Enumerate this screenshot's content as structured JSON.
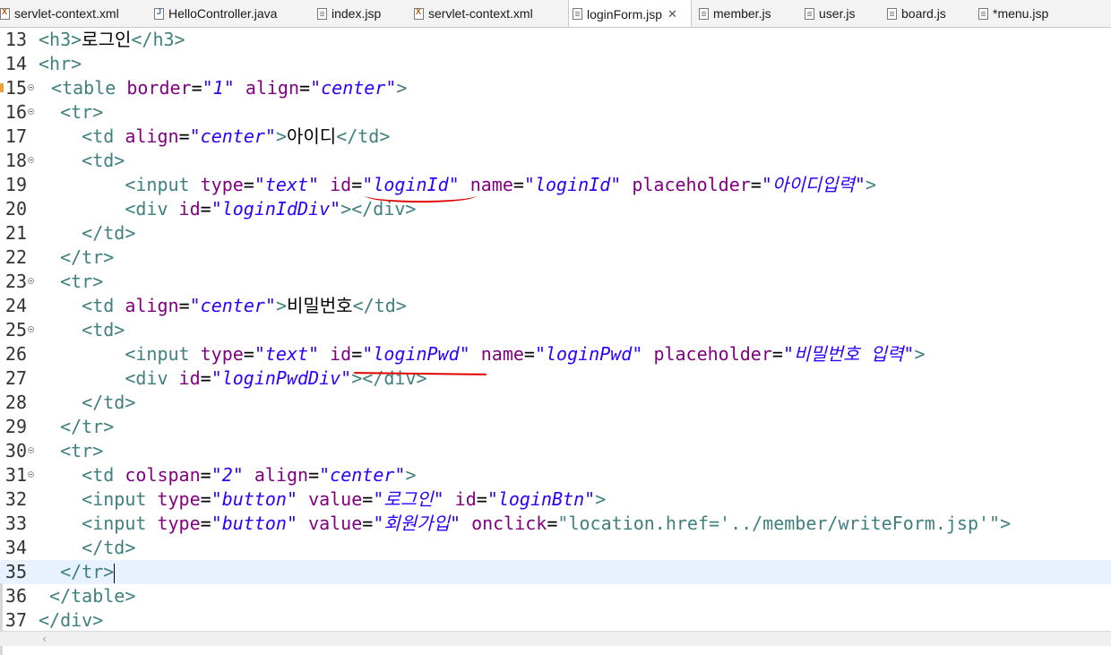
{
  "tabs": [
    {
      "label": "servlet-context.xml",
      "icon": "xml-file-icon"
    },
    {
      "label": "HelloController.java",
      "icon": "java-file-icon"
    },
    {
      "label": "index.jsp",
      "icon": "jsp-file-icon"
    },
    {
      "label": "servlet-context.xml",
      "icon": "xml-file-icon"
    },
    {
      "label": "loginForm.jsp",
      "icon": "jsp-file-icon",
      "active": true
    },
    {
      "label": "member.js",
      "icon": "js-file-icon"
    },
    {
      "label": "user.js",
      "icon": "js-file-icon"
    },
    {
      "label": "board.js",
      "icon": "js-file-icon"
    },
    {
      "label": "*menu.jsp",
      "icon": "jsp-file-icon"
    }
  ],
  "active_tab_close": "✕",
  "editor": {
    "lines": [
      {
        "n": "13"
      },
      {
        "n": "14"
      },
      {
        "n": "15"
      },
      {
        "n": "16"
      },
      {
        "n": "17"
      },
      {
        "n": "18"
      },
      {
        "n": "19"
      },
      {
        "n": "20"
      },
      {
        "n": "21"
      },
      {
        "n": "22"
      },
      {
        "n": "23"
      },
      {
        "n": "24"
      },
      {
        "n": "25"
      },
      {
        "n": "26"
      },
      {
        "n": "27"
      },
      {
        "n": "28"
      },
      {
        "n": "29"
      },
      {
        "n": "30"
      },
      {
        "n": "31"
      },
      {
        "n": "32"
      },
      {
        "n": "33"
      },
      {
        "n": "34"
      },
      {
        "n": "35"
      },
      {
        "n": "36"
      },
      {
        "n": "37"
      }
    ],
    "current_line": "35"
  },
  "text": {
    "l13_title": "로그인",
    "l17_label": "아이디",
    "l19_ph": "\"아이디입력\"",
    "l24_label": "비밀번호",
    "l26_ph": "\"비밀번호 입력\"",
    "l32_value": "\"로그인\"",
    "l33_value": "\"회원가입\"",
    "l33_onclick": "\"location.href='../member/writeForm.jsp'\""
  },
  "colors": {
    "tag": "#3f7f7f",
    "attr": "#7f007f",
    "value": "#2a00ff",
    "annotation": "#e00000"
  }
}
